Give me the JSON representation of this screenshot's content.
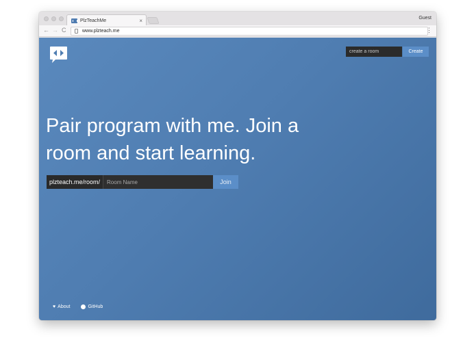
{
  "browser": {
    "tab_title": "PlzTeachMe",
    "tab_close": "×",
    "profile": "Guest",
    "url": "www.plzteach.me",
    "nav": {
      "back": "←",
      "forward": "→",
      "reload": "C"
    },
    "menu": "⋮"
  },
  "header": {
    "create_placeholder": "create a room",
    "create_label": "Create"
  },
  "hero": {
    "line1": "Pair program with me. Join a",
    "line2": "room and start learning."
  },
  "join": {
    "prefix": "plzteach.me/room/",
    "placeholder": "Room Name",
    "button_label": "Join"
  },
  "footer": {
    "about_label": "About",
    "github_label": "GitHub"
  },
  "colors": {
    "accent": "#5b8ec8",
    "background_top": "#5a89bd",
    "background_bottom": "#3f6b9d"
  },
  "icons": {
    "logo": "code-brackets-speech-bubble",
    "about": "heart-icon",
    "github": "github-icon"
  }
}
